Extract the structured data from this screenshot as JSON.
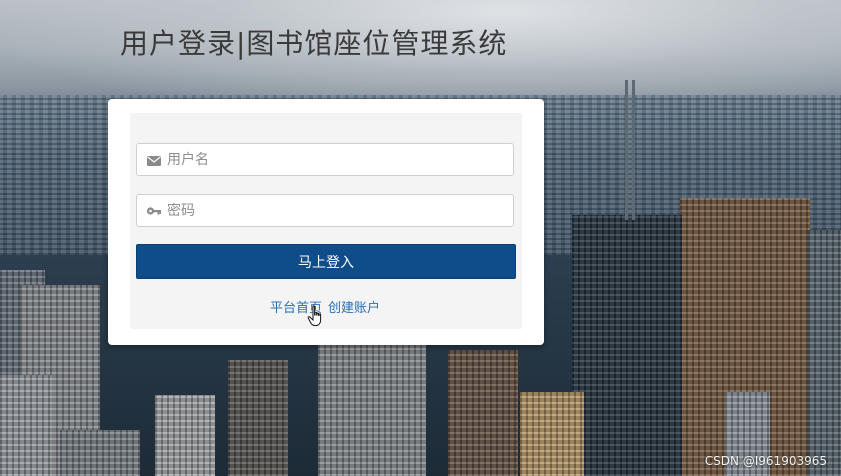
{
  "page": {
    "title": "用户登录|图书馆座位管理系统"
  },
  "form": {
    "username_placeholder": "用户名",
    "username_value": "",
    "username_icon": "envelope-icon",
    "password_placeholder": "密码",
    "password_value": "",
    "password_icon": "key-icon",
    "login_label": "马上登入"
  },
  "links": {
    "home": "平台首页",
    "register": "创建账户"
  },
  "overlay": {
    "watermark": "CSDN @I961903965"
  },
  "colors": {
    "primary": "#0f4c8a",
    "link": "#2a6fb0",
    "title": "#3a3a3a",
    "panel": "#ffffff"
  }
}
